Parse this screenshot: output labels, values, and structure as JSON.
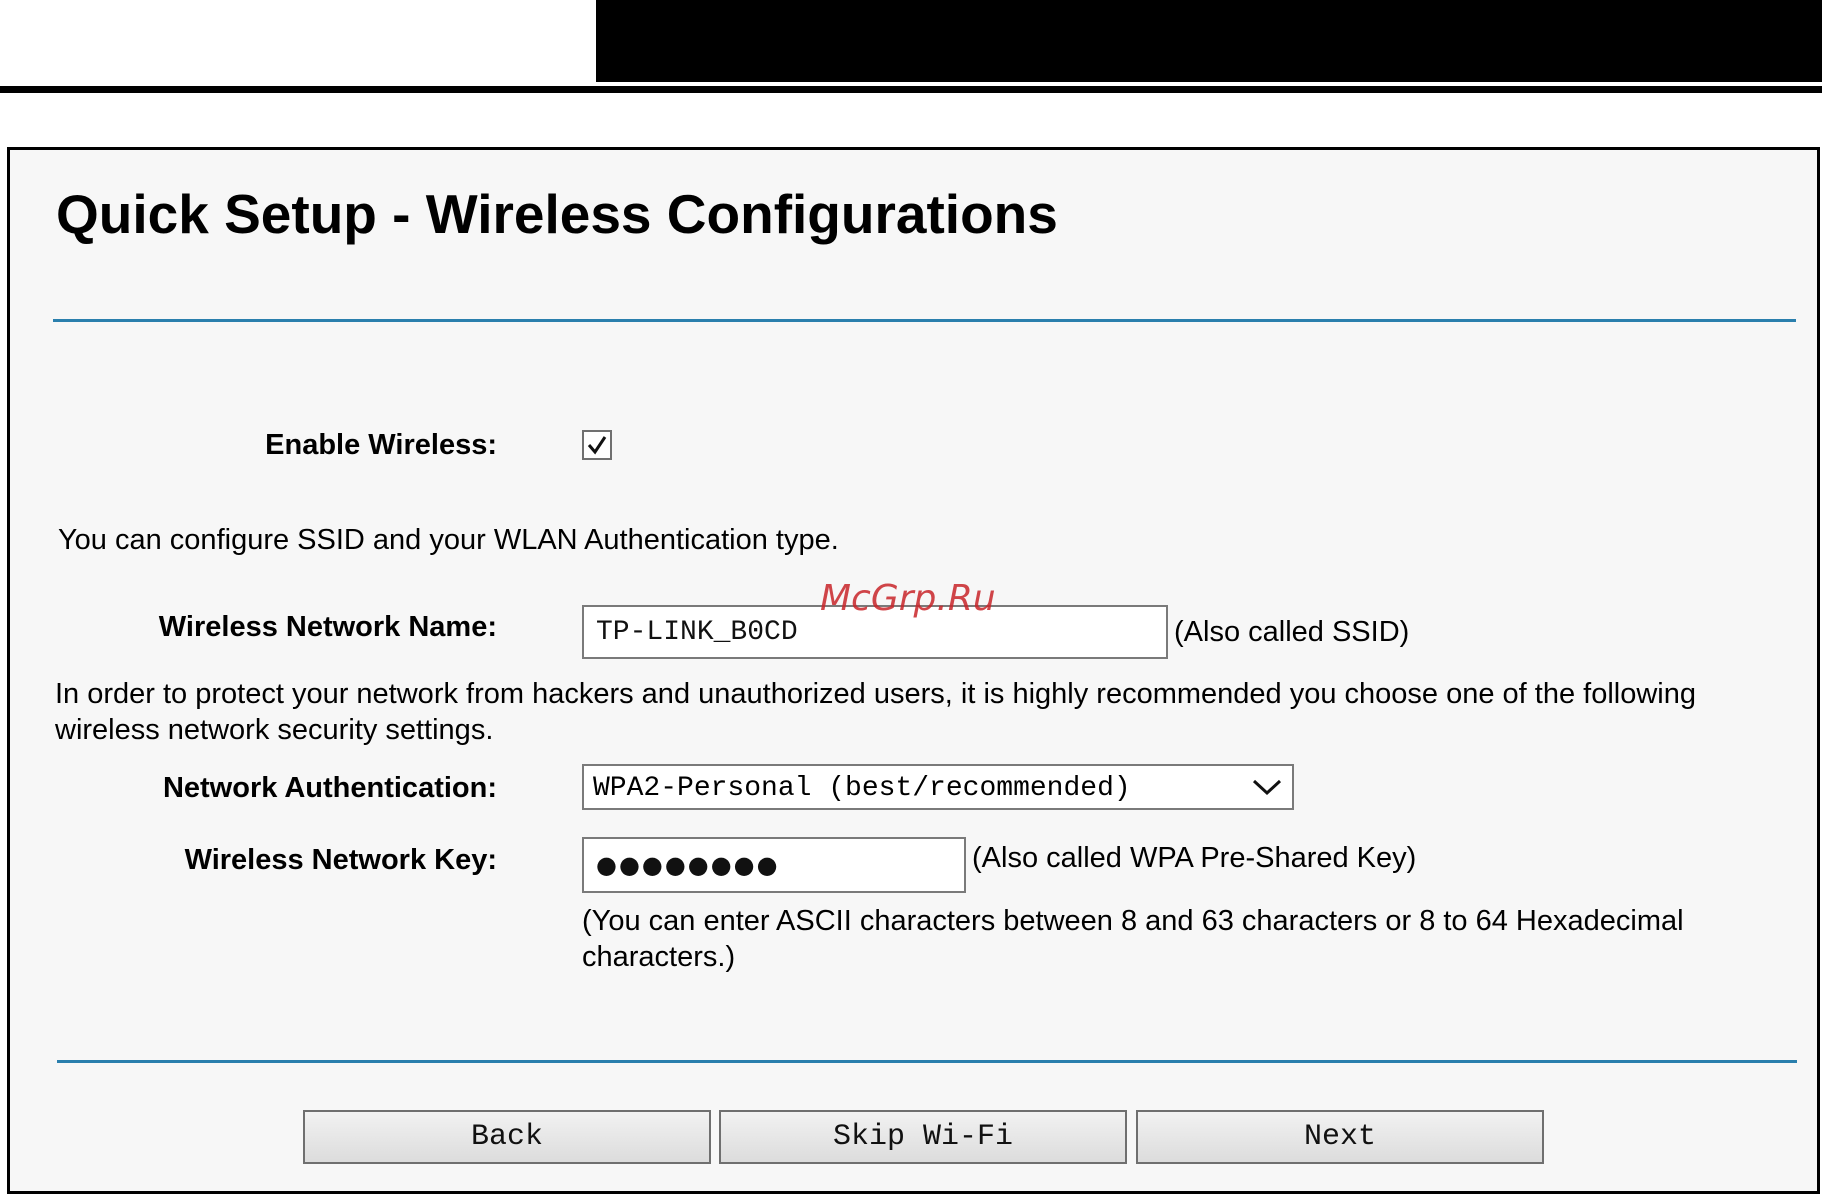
{
  "page": {
    "title": "Quick Setup - Wireless Configurations"
  },
  "enable_wireless": {
    "label": "Enable Wireless:",
    "checked": true
  },
  "intro_text": "You can configure SSID and your WLAN Authentication type.",
  "network_name": {
    "label": "Wireless Network Name:",
    "value": "TP-LINK_B0CD",
    "hint": "(Also called SSID)"
  },
  "security_note": "In order to protect your network from hackers and unauthorized users, it is highly recommended you choose one of the following wireless network security settings.",
  "authentication": {
    "label": "Network Authentication:",
    "selected": "WPA2-Personal (best/recommended)"
  },
  "network_key": {
    "label": "Wireless Network Key:",
    "value": "●●●●●●●●",
    "hint": "(Also called WPA Pre-Shared Key)",
    "help": "(You can enter ASCII characters between 8 and 63 characters or 8 to 64 Hexadecimal characters.)"
  },
  "buttons": {
    "back": "Back",
    "skip": "Skip Wi-Fi",
    "next": "Next"
  },
  "watermark": "McGrp.Ru",
  "colors": {
    "divider": "#2a7fad",
    "panel_bg": "#f7f7f7",
    "watermark": "#c9252a"
  },
  "icons": {
    "checkbox_mark": "checkmark-icon",
    "dropdown": "chevron-down-icon"
  }
}
